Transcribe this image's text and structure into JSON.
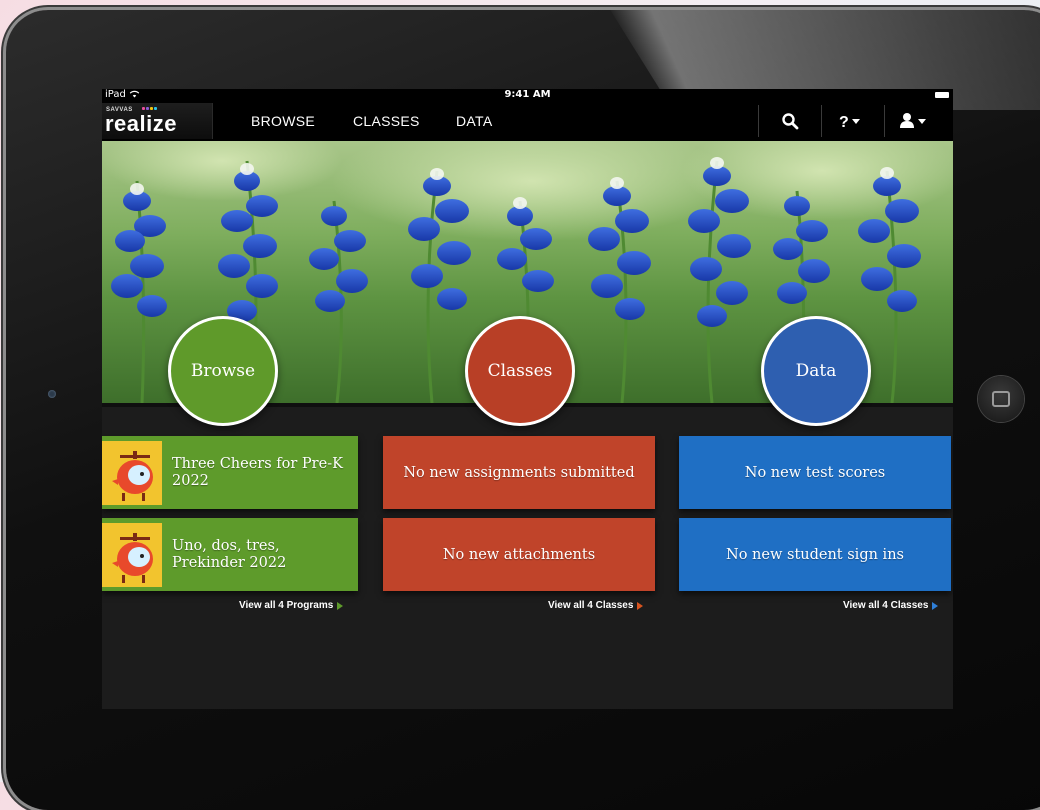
{
  "status_bar": {
    "device": "iPad",
    "time": "9:41 AM"
  },
  "brand": {
    "small": "SAVVAS",
    "name": "realize",
    "tm": "TM"
  },
  "nav": {
    "tabs": [
      "BROWSE",
      "CLASSES",
      "DATA"
    ]
  },
  "hero": {
    "circles": [
      {
        "label": "Browse",
        "color": "#5f9a2a"
      },
      {
        "label": "Classes",
        "color": "#b83f26"
      },
      {
        "label": "Data",
        "color": "#2e5fb0"
      }
    ]
  },
  "programs": {
    "items": [
      {
        "title": "Three Cheers for Pre-K 2022"
      },
      {
        "title": "Uno, dos, tres, Prekinder 2022"
      }
    ],
    "view_all": "View all 4 Programs",
    "color": "#5e9b2b"
  },
  "classes": {
    "items": [
      "No new assignments submitted",
      "No new attachments"
    ],
    "view_all": "View all 4 Classes",
    "color": "#c0442a"
  },
  "data": {
    "items": [
      "No new test scores",
      "No new student sign ins"
    ],
    "view_all": "View all 4 Classes",
    "color": "#1f6fc4"
  }
}
